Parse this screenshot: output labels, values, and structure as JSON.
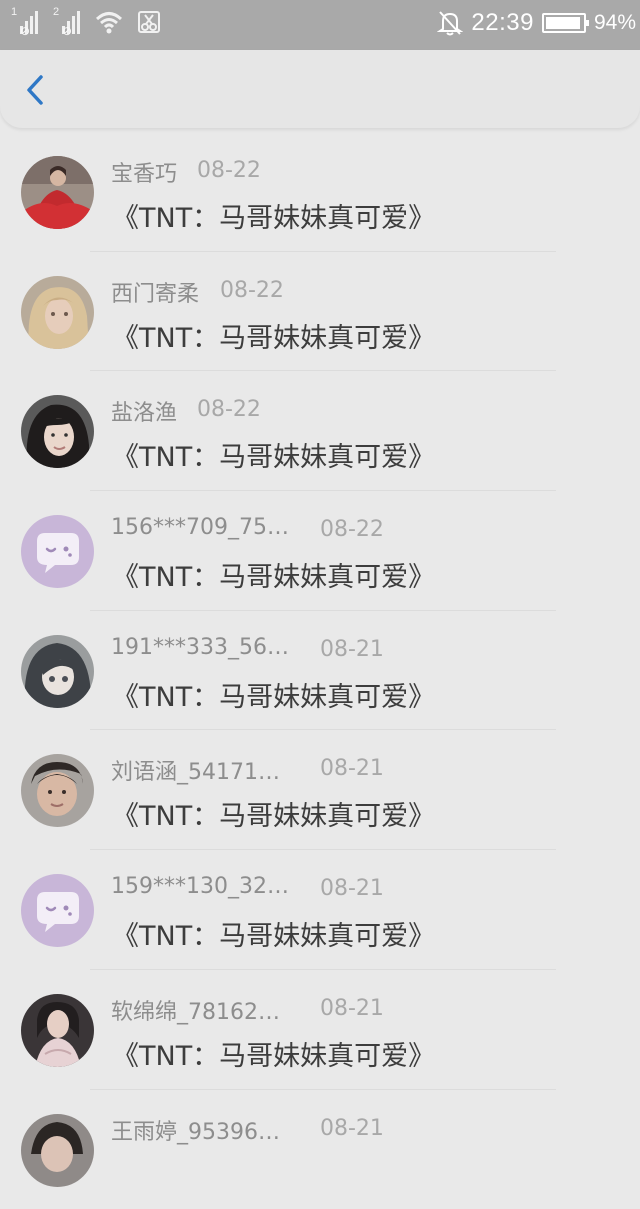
{
  "status_bar": {
    "sim1": "1",
    "sim2": "2",
    "time": "22:39",
    "battery_percent": "94%",
    "battery_level": 0.94
  },
  "header": {
    "back_icon": "chevron-left-icon"
  },
  "comments": [
    {
      "name": "宝香巧",
      "date": "08-22",
      "text": "《TNT：马哥妹妹真可爱》",
      "avatar": "photo-red-dress"
    },
    {
      "name": "西门寄柔",
      "date": "08-22",
      "text": "《TNT：马哥妹妹真可爱》",
      "avatar": "photo-blonde"
    },
    {
      "name": "盐洛渔",
      "date": "08-22",
      "text": "《TNT：马哥妹妹真可爱》",
      "avatar": "photo-dark-hair"
    },
    {
      "name": "156***709_75…",
      "date": "08-22",
      "text": "《TNT：马哥妹妹真可爱》",
      "avatar": "default-chat-avatar"
    },
    {
      "name": "191***333_56…",
      "date": "08-21",
      "text": "《TNT：马哥妹妹真可爱》",
      "avatar": "photo-anime"
    },
    {
      "name": "刘语涵_54171…",
      "date": "08-21",
      "text": "《TNT：马哥妹妹真可爱》",
      "avatar": "photo-face"
    },
    {
      "name": "159***130_32…",
      "date": "08-21",
      "text": "《TNT：马哥妹妹真可爱》",
      "avatar": "default-chat-avatar"
    },
    {
      "name": "软绵绵_78162…",
      "date": "08-21",
      "text": "《TNT：马哥妹妹真可爱》",
      "avatar": "photo-gown"
    },
    {
      "name": "王雨婷_95396…",
      "date": "08-21",
      "text": "",
      "avatar": "photo-partial"
    }
  ],
  "colors": {
    "accent": "#2f78c6",
    "background": "#e9e9e9",
    "default_avatar": "#c8b6d8"
  }
}
